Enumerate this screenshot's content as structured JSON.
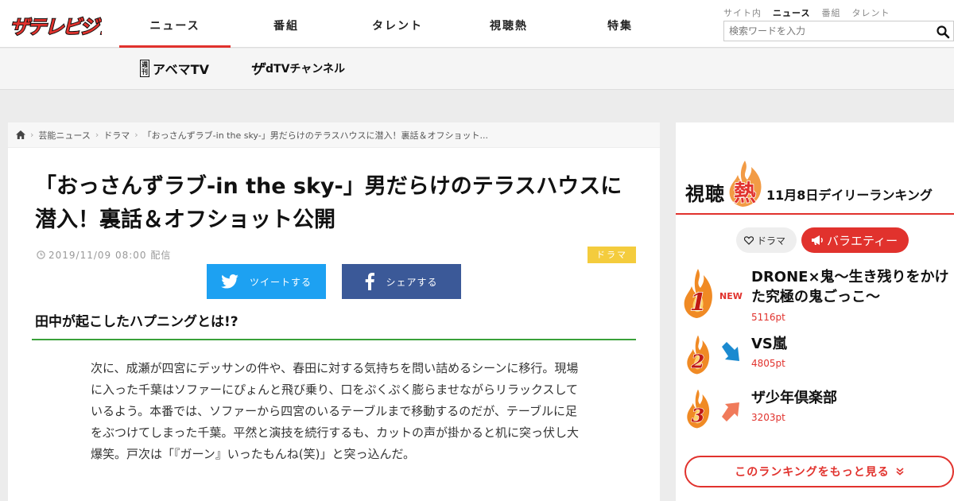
{
  "brand": {
    "logo_text": "ザテレビジョン",
    "accent_color": "#e1322d"
  },
  "nav": {
    "items": [
      {
        "label": "ニュース",
        "active": true
      },
      {
        "label": "番組"
      },
      {
        "label": "タレント"
      },
      {
        "label": "視聴熱"
      },
      {
        "label": "特集"
      }
    ]
  },
  "search": {
    "scopes": [
      "サイト内",
      "ニュース",
      "番組",
      "タレント"
    ],
    "active_scope": "ニュース",
    "placeholder": "検索ワードを入力",
    "icon": "search-icon"
  },
  "subnav": {
    "abema": {
      "badge": "週刊",
      "label": "アベマTV"
    },
    "dtv": {
      "prefix": "ザ",
      "label": "dTVチャンネル"
    }
  },
  "breadcrumb": {
    "items": [
      "芸能ニュース",
      "ドラマ",
      "「おっさんずラブ-in the sky-」男だらけのテラスハウスに潜入！裏話＆オフショット..."
    ],
    "home_icon": "home-icon"
  },
  "article": {
    "title": "「おっさんずラブ-in the sky-」男だらけのテラスハウスに潜入！裏話＆オフショット公開",
    "date": "2019/11/09 08:00 配信",
    "category": "ドラマ",
    "share_twitter": "ツイートする",
    "share_facebook": "シェアする",
    "subheading": "田中が起こしたハプニングとは!?",
    "body": "次に、成瀬が四宮にデッサンの件や、春田に対する気持ちを問い詰めるシーンに移行。現場に入った千葉はソファーにぴょんと飛び乗り、口をぷくぷく膨らませながらリラックスしているよう。本番では、ソファーから四宮のいるテーブルまで移動するのだが、テーブルに足をぶつけてしまった千葉。平然と演技を続行するも、カットの声が掛かると机に突っ伏し大爆笑。戸次は「『ガーン』いったもんね(笑)」と突っ込んだ。"
  },
  "ranking": {
    "heading_left": "視聴",
    "heading_fire": "熱",
    "heading_right": "11月8日デイリーランキング",
    "toggle_drama": "ドラマ",
    "toggle_variety": "バラエティー",
    "active_toggle": "バラエティー",
    "items": [
      {
        "rank": "1",
        "title": "DRONE×鬼〜生き残りをかけた究極の鬼ごっこ〜",
        "points": "5116pt",
        "badge": "NEW"
      },
      {
        "rank": "2",
        "title": "VS嵐",
        "points": "4805pt",
        "trend": "down"
      },
      {
        "rank": "3",
        "title": "ザ少年倶楽部",
        "points": "3203pt",
        "trend": "up"
      }
    ],
    "more_label": "このランキングをもっと見る"
  }
}
